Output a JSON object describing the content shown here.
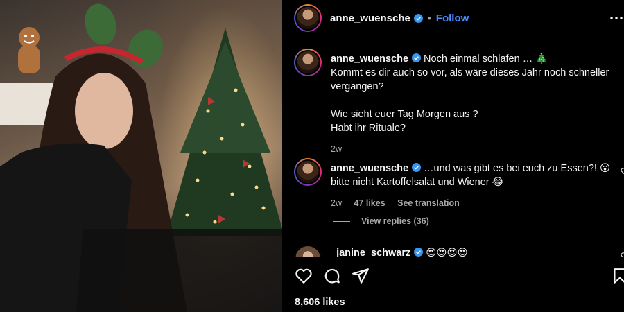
{
  "post": {
    "username": "anne_wuensche",
    "follow_label": "Follow",
    "separator": "•",
    "likes_count": "8,606 likes"
  },
  "comments": [
    {
      "username": "anne_wuensche",
      "lines": [
        "Noch einmal schlafen … 🎄",
        "Kommt es dir auch so vor, als wäre dieses Jahr noch schneller vergangen?",
        "",
        "Wie sieht euer Tag Morgen aus ?",
        "Habt ihr Rituale?"
      ],
      "time": "2w"
    },
    {
      "username": "anne_wuensche",
      "text": "…und was gibt es bei euch zu Essen?! 😮 bitte nicht Kartoffelsalat und Wiener 😂",
      "time": "2w",
      "likes": "47 likes",
      "translate": "See translation",
      "replies": "View replies (36)"
    },
    {
      "username": "_janine_schwarz",
      "text": "😍😍😍😍"
    }
  ],
  "icons": {
    "more": "more-options-icon",
    "like": "heart-icon",
    "comment": "comment-icon",
    "share": "share-icon",
    "save": "bookmark-icon",
    "verified": "verified-badge-icon"
  },
  "colors": {
    "accent": "#4a8cff",
    "verified": "#3897f0",
    "muted": "#a8a8a8"
  }
}
